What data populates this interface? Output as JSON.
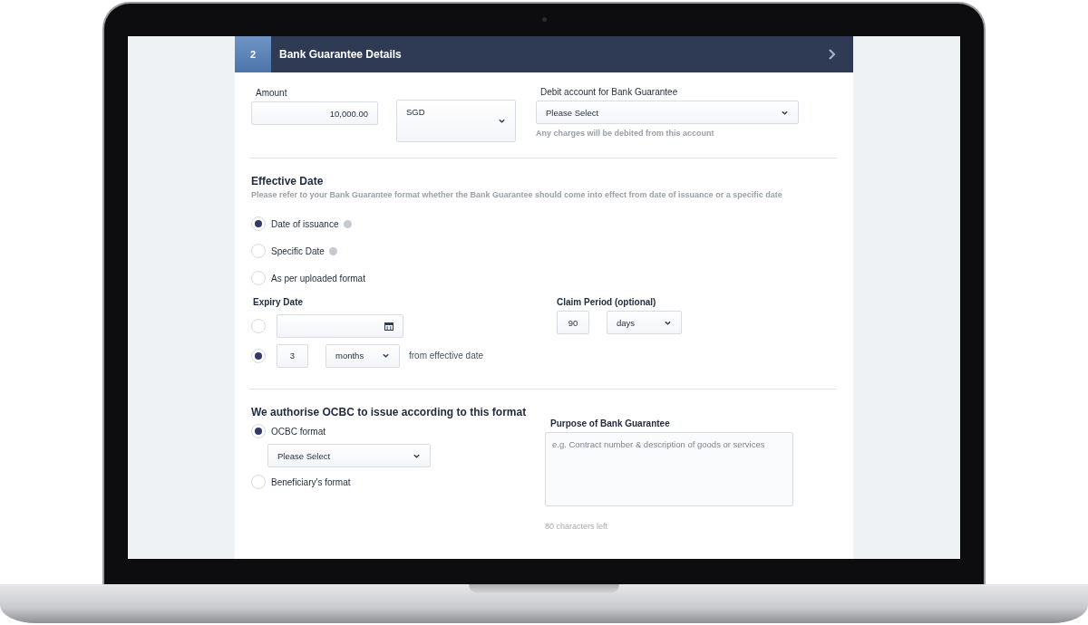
{
  "section": {
    "number": "2",
    "title": "Bank Guarantee Details"
  },
  "amount": {
    "label": "Amount",
    "value": "10,000.00",
    "currency": "SGD"
  },
  "debit_account": {
    "label": "Debit account for Bank Guarantee",
    "value": "Please Select",
    "hint": "Any charges will be debited from this account"
  },
  "effective_date": {
    "title": "Effective Date",
    "description": "Please refer to your Bank Guarantee format whether the Bank Guarantee should come into effect from date of issuance or a specific date",
    "options": [
      {
        "label": "Date of issuance",
        "selected": true,
        "info": true
      },
      {
        "label": "Specific Date",
        "selected": false,
        "info": true
      },
      {
        "label": "As per uploaded format",
        "selected": false,
        "info": false
      }
    ]
  },
  "expiry_date": {
    "label": "Expiry Date",
    "options": [
      {
        "kind": "date",
        "selected": false
      },
      {
        "kind": "period",
        "selected": true,
        "value": "3",
        "unit": "months",
        "suffix": "from effective date"
      }
    ]
  },
  "claim_period": {
    "label": "Claim Period (optional)",
    "value": "90",
    "unit": "days"
  },
  "format": {
    "title": "We authorise OCBC to issue according to this format",
    "options": [
      {
        "label": "OCBC format",
        "selected": true,
        "select": "Please Select"
      },
      {
        "label": "Beneficiary's format",
        "selected": false
      }
    ]
  },
  "purpose": {
    "label": "Purpose of Bank Guarantee",
    "placeholder": "e.g. Contract number & description of goods or services",
    "counter": "80 characters left"
  }
}
